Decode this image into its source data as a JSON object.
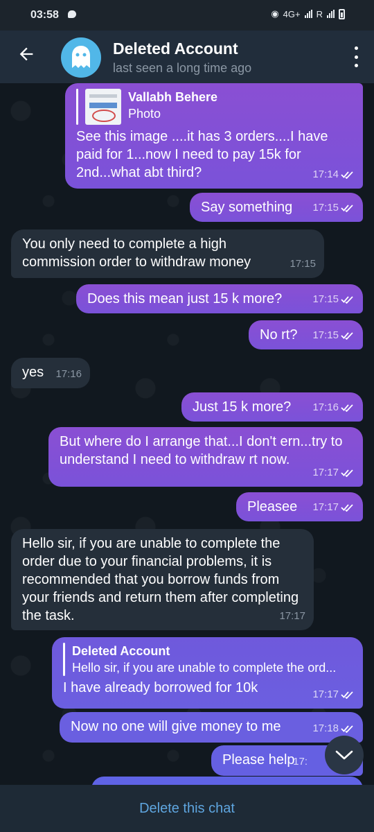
{
  "status_bar": {
    "time": "03:58",
    "network": "4G+",
    "carrier_letter": "R"
  },
  "header": {
    "title": "Deleted Account",
    "subtitle": "last seen a long time ago"
  },
  "messages": [
    {
      "dir": "out",
      "reply_name": "Vallabh Behere",
      "reply_text": "Photo",
      "text": "See this image ....it has 3 orders....I have paid for 1...now I need to pay 15k for 2nd...what abt third?",
      "time": "17:14"
    },
    {
      "dir": "out",
      "text": "Say something",
      "time": "17:15"
    },
    {
      "dir": "in",
      "text": "You only need to complete a high commission order to withdraw money",
      "time": "17:15"
    },
    {
      "dir": "out",
      "text": "Does this mean just 15 k more?",
      "time": "17:15"
    },
    {
      "dir": "out",
      "text": "No rt?",
      "time": "17:15"
    },
    {
      "dir": "in",
      "text": "yes",
      "time": "17:16"
    },
    {
      "dir": "out",
      "text": "Just 15 k more?",
      "time": "17:16"
    },
    {
      "dir": "out",
      "text": "But where do I arrange that...I don't ern...try to understand I need to withdraw rt now.",
      "time": "17:17"
    },
    {
      "dir": "out",
      "text": "Pleasee",
      "time": "17:17"
    },
    {
      "dir": "in",
      "text": "Hello sir, if you are unable to complete the order due to your financial problems, it is recommended that you borrow funds from your friends and return them after completing the task.",
      "time": "17:17"
    },
    {
      "dir": "out",
      "reply_name": "Deleted Account",
      "reply_text": "Hello sir, if you are unable to complete the ord...",
      "text": "I have already borrowed for 10k",
      "time": "17:17"
    },
    {
      "dir": "out",
      "text": "Now no one will give money to me",
      "time": "17:18"
    },
    {
      "dir": "out",
      "text": "Please help",
      "time": "17:"
    }
  ],
  "bottom_action": "Delete this chat",
  "colors": {
    "outgoing": "#8a4fd3",
    "incoming": "#252f3a",
    "accent": "#5fa6e0"
  },
  "icons": [
    "back-arrow-icon",
    "ghost-avatar-icon",
    "more-vert-icon",
    "double-check-icon",
    "chevron-down-icon"
  ]
}
